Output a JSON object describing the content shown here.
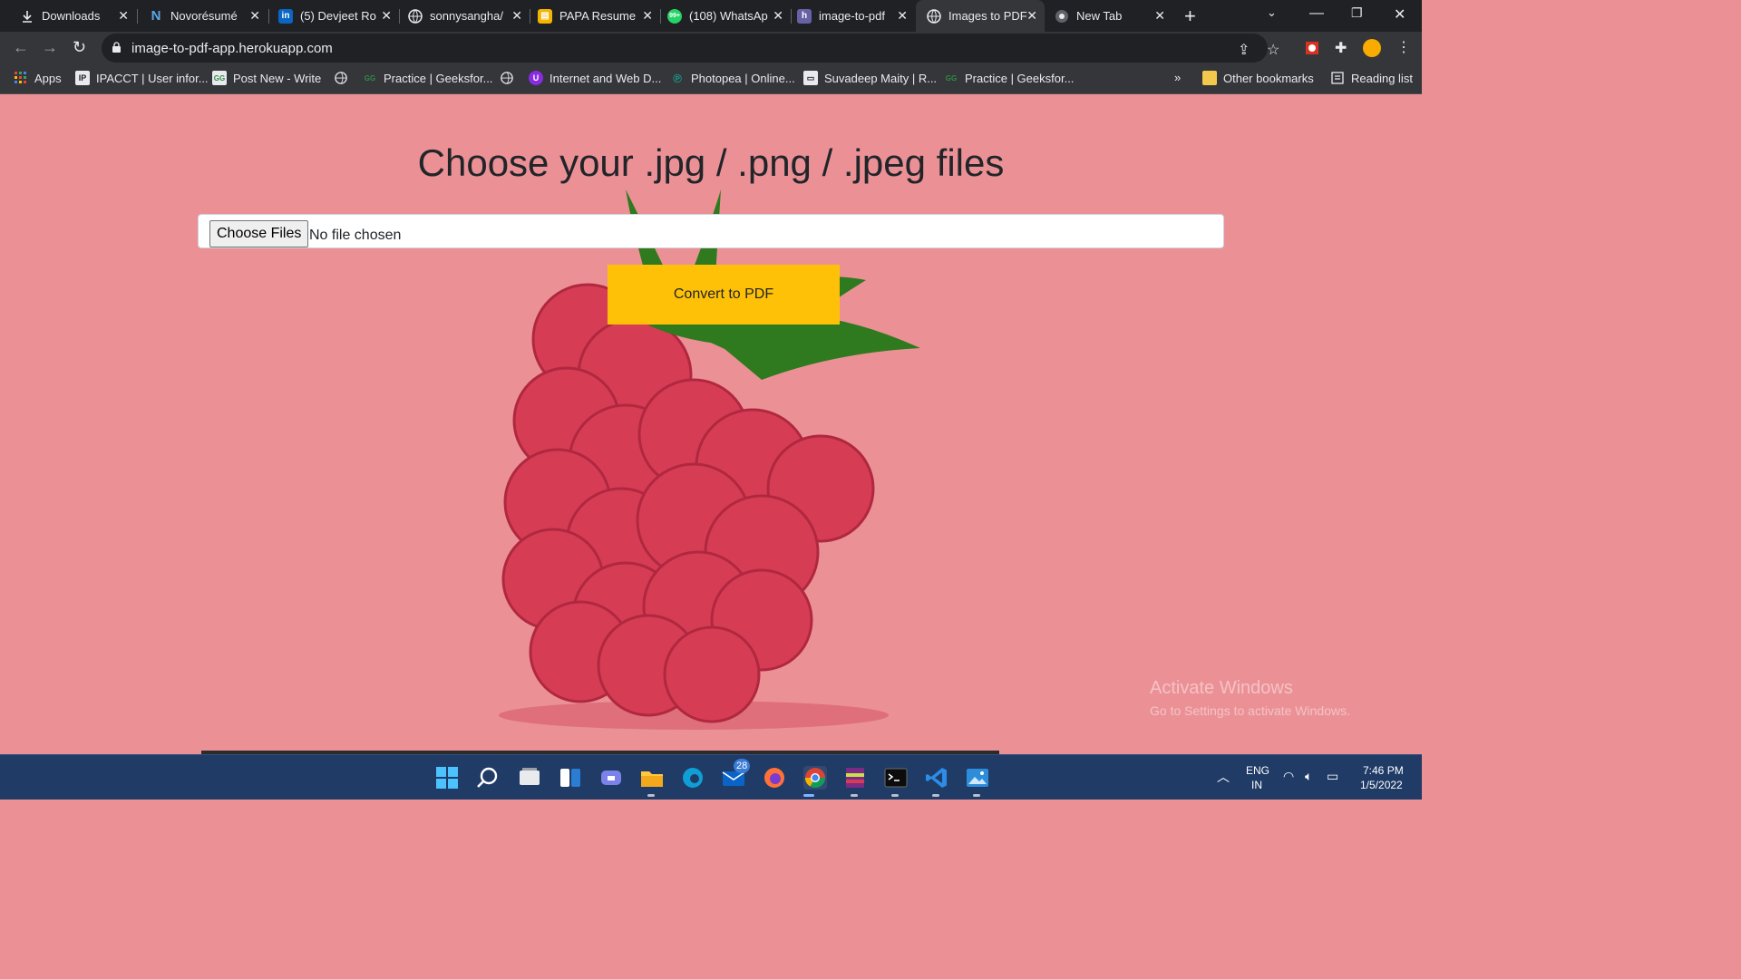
{
  "tabs": [
    {
      "label": "Downloads",
      "icon": "download-icon",
      "active": false
    },
    {
      "label": "Novorésumé",
      "icon": "novoresume-icon",
      "active": false
    },
    {
      "label": "(5) Devjeet Ro",
      "icon": "linkedin-icon",
      "active": false
    },
    {
      "label": "sonnysangha/",
      "icon": "globe-icon",
      "active": false
    },
    {
      "label": "PAPA Resume",
      "icon": "slides-icon",
      "active": false
    },
    {
      "label": "(108) WhatsAp",
      "icon": "whatsapp-icon",
      "active": false
    },
    {
      "label": "image-to-pdf",
      "icon": "heroku-icon",
      "active": false
    },
    {
      "label": "Images to PDF",
      "icon": "globe-icon",
      "active": true
    },
    {
      "label": "New Tab",
      "icon": "chrome-icon",
      "active": false
    }
  ],
  "address_bar": {
    "url": "image-to-pdf-app.herokuapp.com"
  },
  "bookmarks": [
    {
      "label": "Apps",
      "icon": "apps-grid-icon"
    },
    {
      "label": "IPACCT | User infor...",
      "icon": "ipacct-icon"
    },
    {
      "label": "Post New - Write",
      "icon": "gfg-icon"
    },
    {
      "label": "",
      "icon": "globe-icon"
    },
    {
      "label": "Practice | Geeksfor...",
      "icon": "gfg-icon"
    },
    {
      "label": "",
      "icon": "globe-icon"
    },
    {
      "label": "Internet and Web D...",
      "icon": "purple-u-icon"
    },
    {
      "label": "Photopea | Online...",
      "icon": "photopea-icon"
    },
    {
      "label": "Suvadeep Maity | R...",
      "icon": "page-icon"
    },
    {
      "label": "Practice | Geeksfor...",
      "icon": "gfg-icon"
    }
  ],
  "bookmarks_more": "»",
  "other_bookmarks": "Other bookmarks",
  "reading_list": "Reading list",
  "page": {
    "heading": "Choose your .jpg / .png / .jpeg files",
    "choose_files_label": "Choose Files",
    "no_file_text": "No file chosen",
    "convert_label": "Convert to PDF"
  },
  "watermark": {
    "title": "Activate Windows",
    "subtitle": "Go to Settings to activate Windows."
  },
  "taskbar": {
    "mail_badge": "28",
    "language_top": "ENG",
    "language_bottom": "IN",
    "time": "7:46 PM",
    "date": "1/5/2022"
  },
  "colors": {
    "page_background": "#eb9196",
    "convert_button": "#ffc107",
    "taskbar": "#1f3b66"
  }
}
